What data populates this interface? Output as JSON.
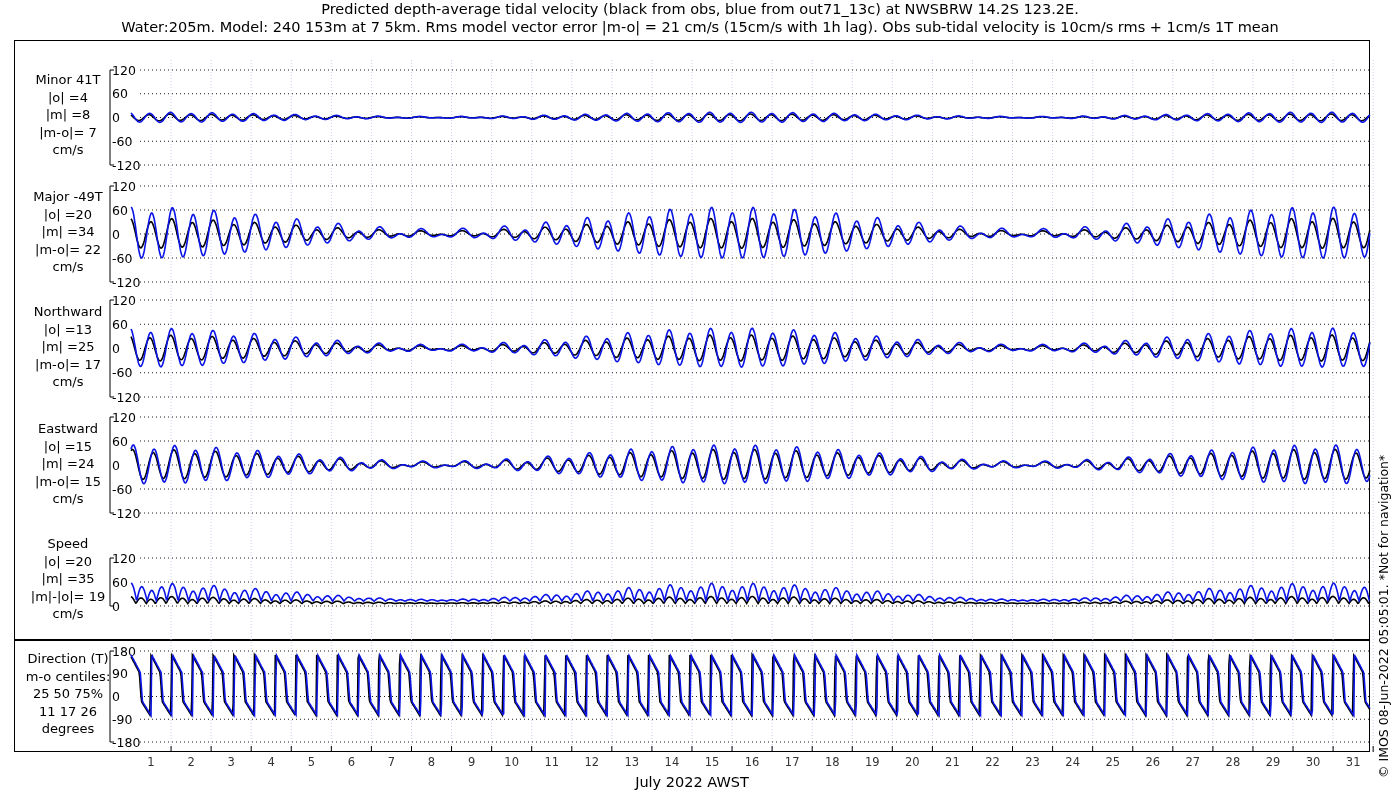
{
  "title": {
    "line_1": "Predicted depth-average tidal velocity (black from obs, blue from out71_13c) at NWSBRW 14.2S 123.2E.",
    "line_2": "Water:205m. Model: 240 153m at 7 5km. Rms model vector error |m-o| = 21 cm/s (15cm/s with 1h lag). Obs sub-tidal velocity is 10cm/s rms + 1cm/s 1T mean"
  },
  "panels": [
    {
      "kind": "component",
      "label_lines": [
        "Minor 41T",
        "|o| =4",
        "|m| =8",
        "|m-o|= 7",
        "cm/s"
      ],
      "yticks": [
        "120",
        "60",
        "0",
        "-60",
        "-120"
      ]
    },
    {
      "kind": "component",
      "label_lines": [
        "Major -49T",
        "|o| =20",
        "|m| =34",
        "|m-o|= 22",
        "cm/s"
      ],
      "yticks": [
        "120",
        "60",
        "0",
        "-60",
        "-120"
      ]
    },
    {
      "kind": "component",
      "label_lines": [
        "Northward",
        "|o| =13",
        "|m| =25",
        "|m-o|= 17",
        "cm/s"
      ],
      "yticks": [
        "120",
        "60",
        "0",
        "-60",
        "-120"
      ]
    },
    {
      "kind": "component",
      "label_lines": [
        "Eastward",
        "|o| =15",
        "|m| =24",
        "|m-o|= 15",
        "cm/s"
      ],
      "yticks": [
        "120",
        "60",
        "0",
        "-60",
        "-120"
      ]
    },
    {
      "kind": "speed",
      "label_lines": [
        "Speed",
        "|o| =20",
        "|m| =35",
        "|m|-|o|= 19",
        "cm/s"
      ],
      "yticks": [
        "120",
        "60",
        "0"
      ]
    },
    {
      "kind": "direction",
      "label_lines": [
        "Direction (T)",
        "m-o centiles:",
        "25  50  75%",
        "11  17  26",
        "degrees"
      ],
      "yticks": [
        "180",
        "90",
        "0",
        "-90",
        "-180"
      ]
    }
  ],
  "xaxis": {
    "day_labels": [
      "1",
      "2",
      "3",
      "4",
      "5",
      "6",
      "7",
      "8",
      "9",
      "10",
      "11",
      "12",
      "13",
      "14",
      "15",
      "16",
      "17",
      "18",
      "19",
      "20",
      "21",
      "22",
      "23",
      "24",
      "25",
      "26",
      "27",
      "28",
      "29",
      "30",
      "31"
    ],
    "xlabel": "July 2022 AWST"
  },
  "credit": "© IMOS 08-Jun-2022 05:05:01. *Not for navigation*"
}
